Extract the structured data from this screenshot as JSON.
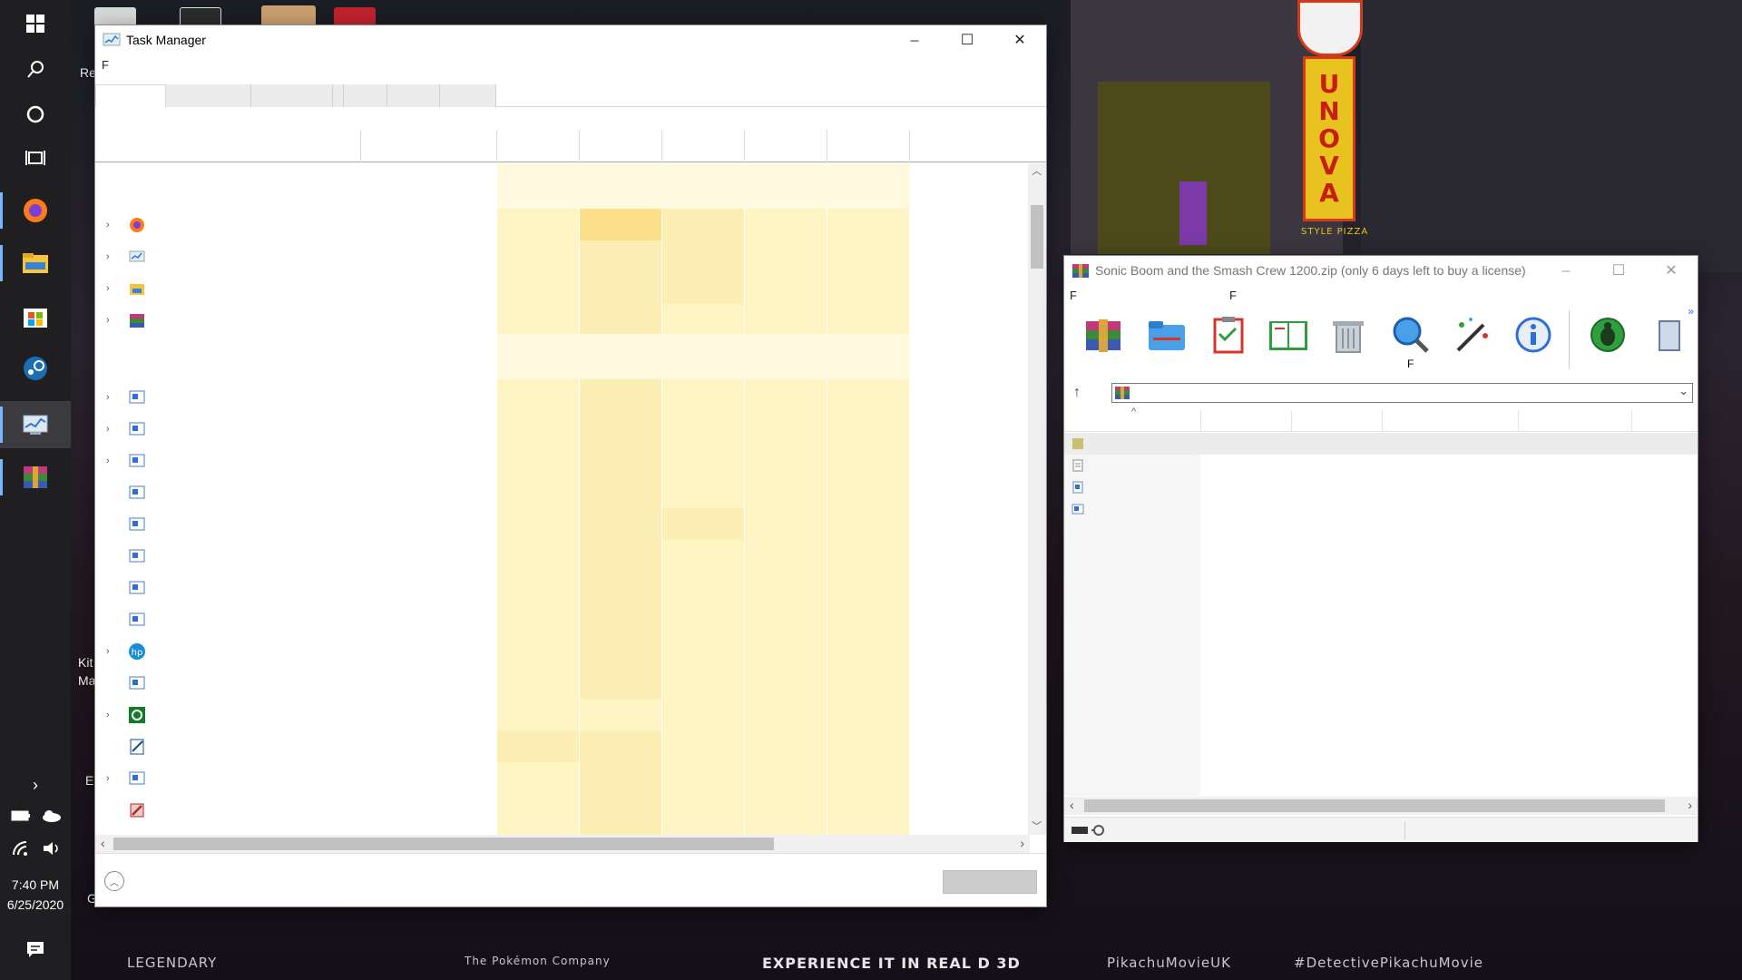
{
  "desktop": {
    "labels": [
      "Re",
      "Kit",
      "Ma",
      "Er",
      "G"
    ],
    "wallpaper_texts": [
      "LEGENDARY",
      "The Pokémon Company",
      "EXPERIENCE IT IN REAL D 3D",
      "PikachuMovieUK",
      "#DetectivePikachuMovie"
    ],
    "sign_text": [
      "U",
      "N",
      "O",
      "V",
      "A"
    ],
    "sign_sub": "STYLE PIZZA"
  },
  "taskbar": {
    "clock_time": "7:40 PM",
    "clock_date": "6/25/2020",
    "buttons": [
      "start-icon",
      "search-icon",
      "cortana-icon",
      "task-view-icon",
      "firefox-icon",
      "file-explorer-icon",
      "store-icon",
      "steam-icon",
      "task-manager-icon",
      "winrar-icon"
    ]
  },
  "task_manager": {
    "title": "Task Manager",
    "menu": [
      "F"
    ],
    "heat_color": "#fff4c4",
    "heat_strong": "#fde8a0"
  },
  "winrar": {
    "title": "Sonic Boom and the Smash Crew 1200.zip (only 6 days left to buy a license)",
    "menu": [
      "F",
      "F"
    ],
    "toolbar_label": "F",
    "sort_arrow": "^",
    "colors": {
      "red": "#d8352a",
      "green": "#2e9e3e",
      "blue": "#2c6fd6"
    }
  },
  "icons": {
    "minimize": "─",
    "maximize": "☐",
    "close": "✕",
    "expand": "›",
    "up": "↑",
    "dropdown": "⌄",
    "scroll_up": "︿",
    "scroll_down": "﹀",
    "scroll_left": "‹",
    "scroll_right": "›",
    "fewer_details": "︿",
    "more": "»"
  }
}
